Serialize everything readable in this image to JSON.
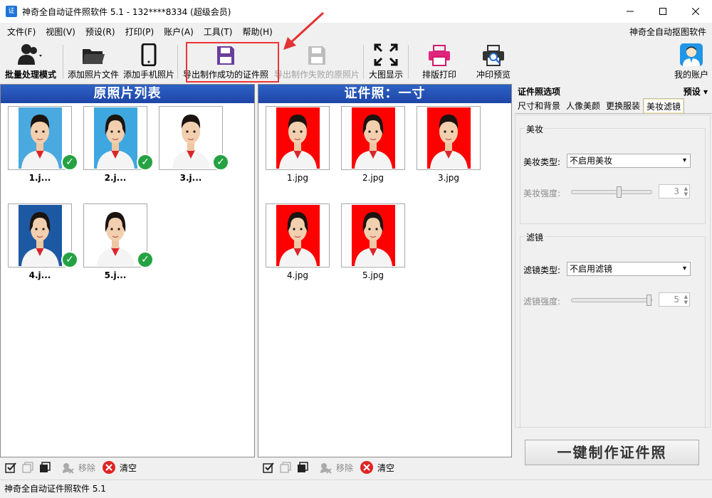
{
  "window": {
    "title": "神奇全自动证件照软件 5.1 - 132****8334 (超级会员)",
    "app_icon_text": "证"
  },
  "menu": {
    "items": [
      "文件(F)",
      "视图(V)",
      "预设(R)",
      "打印(P)",
      "账户(A)",
      "工具(T)",
      "帮助(H)"
    ],
    "right_link": "神奇全自动抠图软件"
  },
  "toolbar": {
    "batch_mode": "批量处理模式",
    "add_files": "添加照片文件",
    "add_phone": "添加手机照片",
    "export_success": "导出制作成功的证件照",
    "export_failed": "导出制作失败的原照片",
    "large_view": "大图显示",
    "layout_print": "排版打印",
    "print_preview": "冲印预览",
    "my_account": "我的账户"
  },
  "left_panel": {
    "title": "原照片列表",
    "photos": [
      {
        "caption": "1.j...",
        "bg": "#4aa9de"
      },
      {
        "caption": "2.j...",
        "bg": "#3fa7df"
      },
      {
        "caption": "3.j...",
        "bg": "#ffffff"
      },
      {
        "caption": "4.j...",
        "bg": "#1d59a3"
      },
      {
        "caption": "5.j...",
        "bg": "#ffffff"
      }
    ],
    "bottom": {
      "remove": "移除",
      "clear": "清空"
    }
  },
  "middle_panel": {
    "title": "证件照：一寸",
    "photos": [
      {
        "caption": "1.jpg",
        "bg": "#ff0000"
      },
      {
        "caption": "2.jpg",
        "bg": "#ff0000"
      },
      {
        "caption": "3.jpg",
        "bg": "#ff0000"
      },
      {
        "caption": "4.jpg",
        "bg": "#ff0000"
      },
      {
        "caption": "5.jpg",
        "bg": "#ff0000"
      }
    ],
    "bottom": {
      "remove": "移除",
      "clear": "清空"
    }
  },
  "right_panel": {
    "title": "证件照选项",
    "preset": "预设",
    "tabs": [
      "尺寸和背景",
      "人像美颜",
      "更换服装",
      "美妆滤镜"
    ],
    "makeup": {
      "group_title": "美妆",
      "type_label": "美妆类型:",
      "type_value": "不启用美妆",
      "strength_label": "美妆强度:",
      "strength_value": "3",
      "strength_level": 0.6
    },
    "filter": {
      "group_title": "滤镜",
      "type_label": "滤镜类型:",
      "type_value": "不启用滤镜",
      "strength_label": "滤镜强度:",
      "strength_value": "5",
      "strength_level": 1.0
    },
    "make_button": "一键制作证件照"
  },
  "status": {
    "text": "神奇全自动证件照软件 5.1"
  },
  "colors": {
    "accent_red": "#e33333",
    "panel_header": "#2450b5",
    "check_green": "#25a243"
  }
}
